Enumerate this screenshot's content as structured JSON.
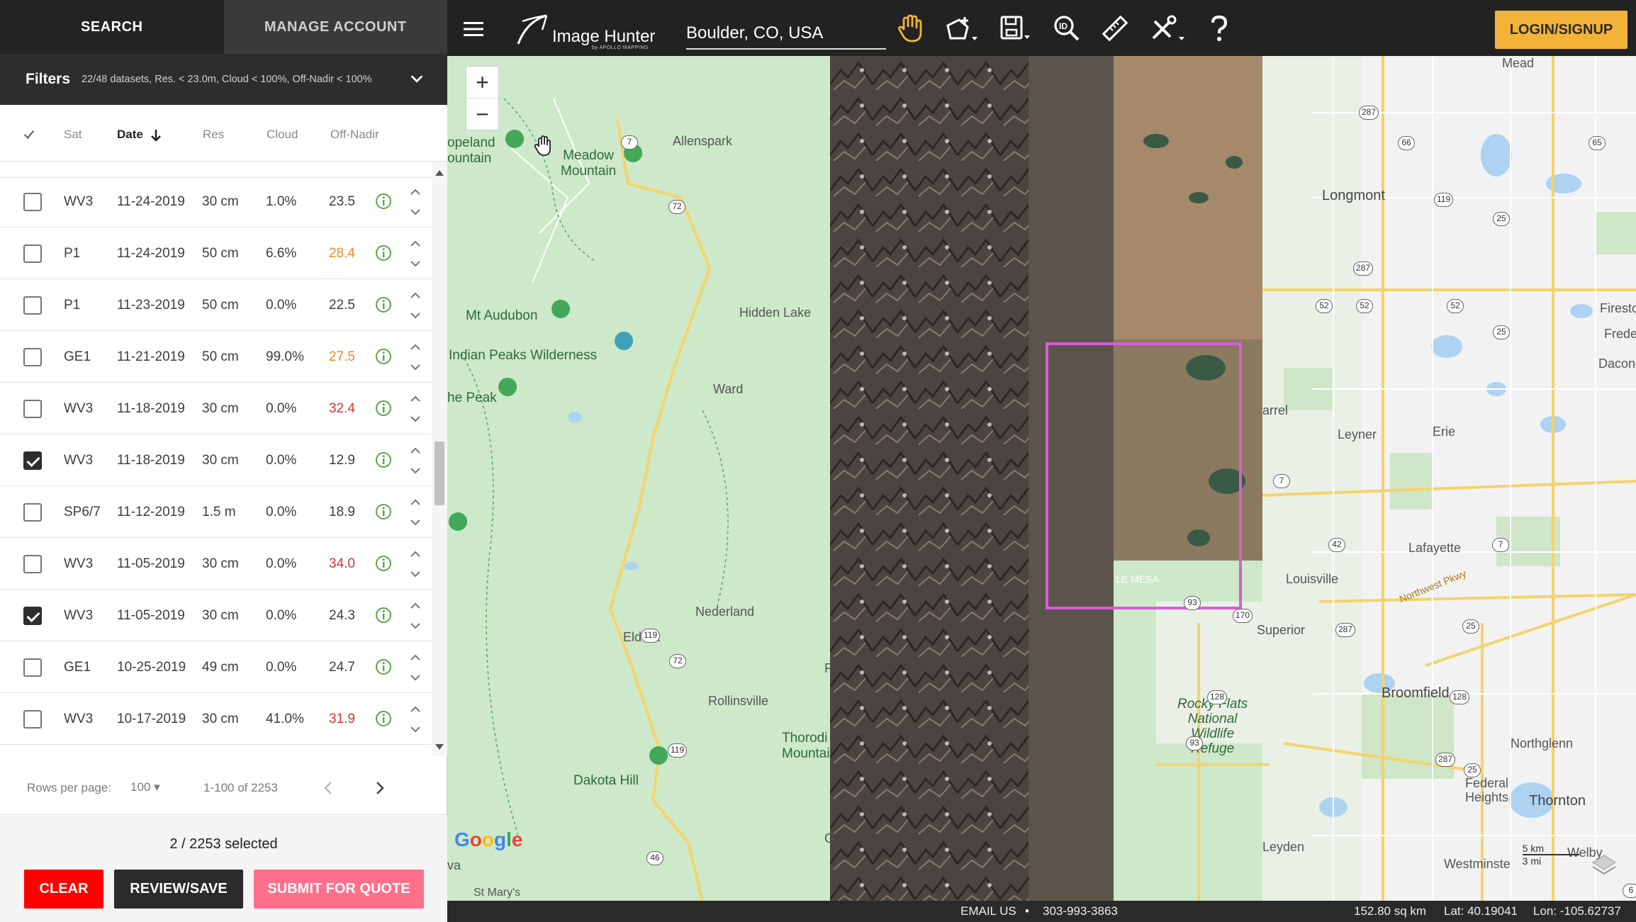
{
  "tabs": {
    "search": "SEARCH",
    "manage": "MANAGE ACCOUNT"
  },
  "filters": {
    "title": "Filters",
    "summary": "22/48 datasets, Res. < 23.0m, Cloud < 100%, Off-Nadir < 100%"
  },
  "table": {
    "columns": {
      "sat": "Sat",
      "date": "Date",
      "res": "Res",
      "cloud": "Cloud",
      "offnadir": "Off-Nadir"
    },
    "rows": [
      {
        "sat": "WV3",
        "date": "11-24-2019",
        "res": "30 cm",
        "cloud": "1.0%",
        "offnadir": "23.5",
        "checked": false,
        "warn": ""
      },
      {
        "sat": "P1",
        "date": "11-24-2019",
        "res": "50 cm",
        "cloud": "6.6%",
        "offnadir": "28.4",
        "checked": false,
        "warn": "o"
      },
      {
        "sat": "P1",
        "date": "11-23-2019",
        "res": "50 cm",
        "cloud": "0.0%",
        "offnadir": "22.5",
        "checked": false,
        "warn": ""
      },
      {
        "sat": "GE1",
        "date": "11-21-2019",
        "res": "50 cm",
        "cloud": "99.0%",
        "offnadir": "27.5",
        "checked": false,
        "warn": "o"
      },
      {
        "sat": "WV3",
        "date": "11-18-2019",
        "res": "30 cm",
        "cloud": "0.0%",
        "offnadir": "32.4",
        "checked": false,
        "warn": "r"
      },
      {
        "sat": "WV3",
        "date": "11-18-2019",
        "res": "30 cm",
        "cloud": "0.0%",
        "offnadir": "12.9",
        "checked": true,
        "warn": ""
      },
      {
        "sat": "SP6/7",
        "date": "11-12-2019",
        "res": "1.5 m",
        "cloud": "0.0%",
        "offnadir": "18.9",
        "checked": false,
        "warn": ""
      },
      {
        "sat": "WV3",
        "date": "11-05-2019",
        "res": "30 cm",
        "cloud": "0.0%",
        "offnadir": "34.0",
        "checked": false,
        "warn": "r"
      },
      {
        "sat": "WV3",
        "date": "11-05-2019",
        "res": "30 cm",
        "cloud": "0.0%",
        "offnadir": "24.3",
        "checked": true,
        "warn": ""
      },
      {
        "sat": "GE1",
        "date": "10-25-2019",
        "res": "49 cm",
        "cloud": "0.0%",
        "offnadir": "24.7",
        "checked": false,
        "warn": ""
      },
      {
        "sat": "WV3",
        "date": "10-17-2019",
        "res": "30 cm",
        "cloud": "41.0%",
        "offnadir": "31.9",
        "checked": false,
        "warn": "r"
      }
    ]
  },
  "pager": {
    "rows_label": "Rows per page:",
    "rows_value": "100",
    "range": "1-100 of 2253"
  },
  "footer": {
    "selected": "2 / 2253 selected",
    "clear": "CLEAR",
    "review": "REVIEW/SAVE",
    "submit": "SUBMIT FOR QUOTE"
  },
  "topbar": {
    "logo": "Image Hunter",
    "logo_sub": "by APOLLO MAPPING",
    "location": "Boulder, CO, USA",
    "login": "LOGIN/SIGNUP"
  },
  "map": {
    "labels": {
      "copeland": "opeland\nountain",
      "meadow": "Meadow\nMountain",
      "allenspark": "Allenspark",
      "longmont": "Longmont",
      "mt_audubon": "Mt Audubon",
      "hidden_lake": "Hidden Lake",
      "indian_peaks": "Indian Peaks Wilderness",
      "peak": "he Peak",
      "ward": "Ward",
      "firestone": "Firestone",
      "frederick": "Frederick",
      "dacono": "Dacono",
      "leyner": "Leyner",
      "erie": "Erie",
      "arrel": "arrel",
      "lafayette": "Lafayette",
      "louisville": "Louisville",
      "le_mesa": "LE MESA",
      "northwest_pkwy": "Northwest Pkwy",
      "superior": "Superior",
      "nederland": "Nederland",
      "eldora": "Eldora",
      "rollinsville": "Rollinsville",
      "thorodin": "Thorodi\nMountai",
      "broomfield": "Broomfield",
      "rocky_flats": "Rocky Flats\nNational\nWildlife\nRefuge",
      "northglenn": "Northglenn",
      "thornton": "Thornton",
      "dakota_hill": "Dakota Hill",
      "federal_heights": "Federal\nHeights",
      "leyden": "Leyden",
      "westminster": "Westminste",
      "wellby": "Welby",
      "st_marys": "St Mary's",
      "mead": "Mead",
      "va": "va",
      "p_letter": "P",
      "g_letter": "G"
    },
    "shields": [
      "7",
      "287",
      "66",
      "65",
      "119",
      "25",
      "72",
      "287",
      "52",
      "52",
      "52",
      "25",
      "7",
      "42",
      "7",
      "93",
      "170",
      "287",
      "25",
      "119",
      "72",
      "128",
      "93",
      "128",
      "287",
      "119",
      "25",
      "46",
      "6"
    ],
    "google": "Google",
    "scale_km": "5 km",
    "scale_mi": "3 mi"
  },
  "status": {
    "email": "EMAIL US",
    "phone": "303-993-3863",
    "area": "152.80 sq km",
    "lat": "Lat: 40.19041",
    "lon": "Lon: -105.62737"
  },
  "colors": {
    "accent": "#f3b339",
    "clear": "#ff0000",
    "submit": "#ff6f8a",
    "aoi": "#d55fd5",
    "warn_orange": "#e88a2f",
    "warn_red": "#d93434"
  }
}
